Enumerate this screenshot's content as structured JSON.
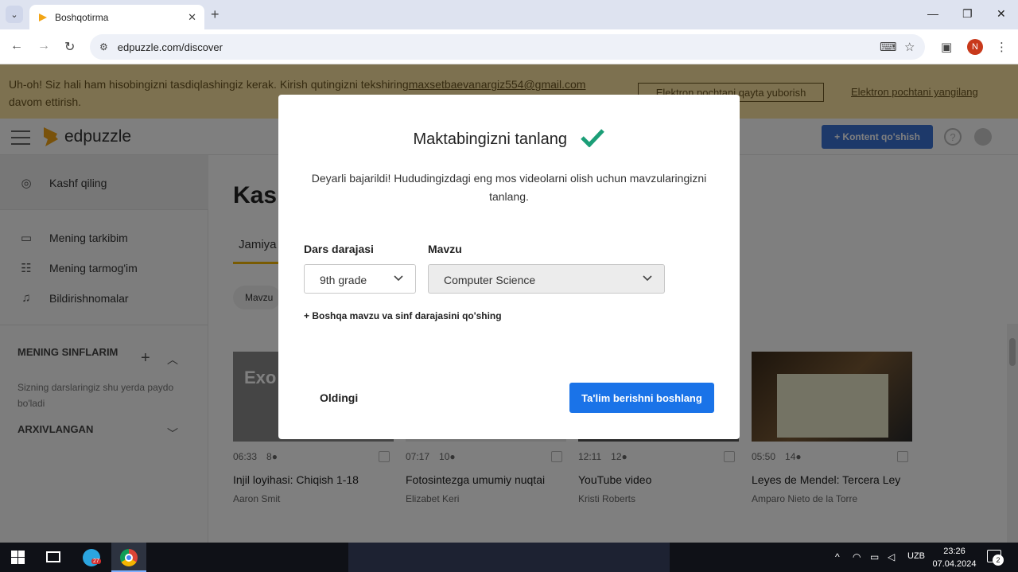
{
  "browser": {
    "tab_title": "Boshqotirma",
    "url": "edpuzzle.com/discover",
    "profile_initial": "N"
  },
  "banner": {
    "message": "Uh-oh! Siz hali ham hisobingizni tasdiqlashingiz kerak. Kirish qutingizni tekshiring",
    "email": "maxsetbaevanargiz554@gmail.com",
    "message_end": "davom ettirish.",
    "resend_label": "Elektron pochtani qayta yuborish",
    "update_label": "Elektron pochtani yangilang"
  },
  "header": {
    "logo_text": "edpuzzle",
    "add_content_label": "+ Kontent qo'shish",
    "help_label": "?"
  },
  "sidebar": {
    "discover_label": "Kashf qiling",
    "items": [
      {
        "label": "Mening tarkibim",
        "icon": "folder-icon"
      },
      {
        "label": "Mening tarmog'im",
        "icon": "network-icon"
      },
      {
        "label": "Bildirishnomalar",
        "icon": "bell-icon"
      }
    ],
    "classes_heading": "MENING SINFLARIM",
    "classes_hint": "Sizning darslaringiz shu yerda paydo bo'ladi",
    "archived_heading": "ARXIVLANGAN"
  },
  "main": {
    "title": "Kash",
    "tab_label": "Jamiya",
    "filter_label": "Mavzu"
  },
  "cards": [
    {
      "duration": "06:33",
      "questions": "8",
      "title": "Injil loyihasi: Chiqish 1-18",
      "author": "Aaron Smit",
      "thumb_text": "Exo"
    },
    {
      "duration": "07:17",
      "questions": "10",
      "title": "Fotosintezga umumiy nuqtai",
      "author": "Elizabet Keri",
      "thumb_text": ""
    },
    {
      "duration": "12:11",
      "questions": "12",
      "title": "YouTube video",
      "author": "Kristi Roberts",
      "thumb_text": ""
    },
    {
      "duration": "05:50",
      "questions": "14",
      "title": "Leyes de Mendel: Tercera Ley",
      "author": "Amparo Nieto de la Torre",
      "thumb_text": ""
    }
  ],
  "modal": {
    "title": "Maktabingizni tanlang",
    "description": "Deyarli bajarildi! Hududingizdagi eng mos videolarni olish uchun mavzularingizni tanlang.",
    "grade_label": "Dars darajasi",
    "grade_value": "9th grade",
    "subject_label": "Mavzu",
    "subject_value": "Computer Science",
    "add_subject_link": "+ Boshqa mavzu va sinf darajasini qo'shing",
    "back_label": "Oldingi",
    "start_label": "Ta'lim berishni boshlang",
    "accent_color": "#1a73e8",
    "check_color": "#1b9e77"
  },
  "taskbar": {
    "telegram_badge": "27",
    "language": "UZB",
    "time": "23:26",
    "date": "07.04.2024",
    "notifications": "2"
  }
}
